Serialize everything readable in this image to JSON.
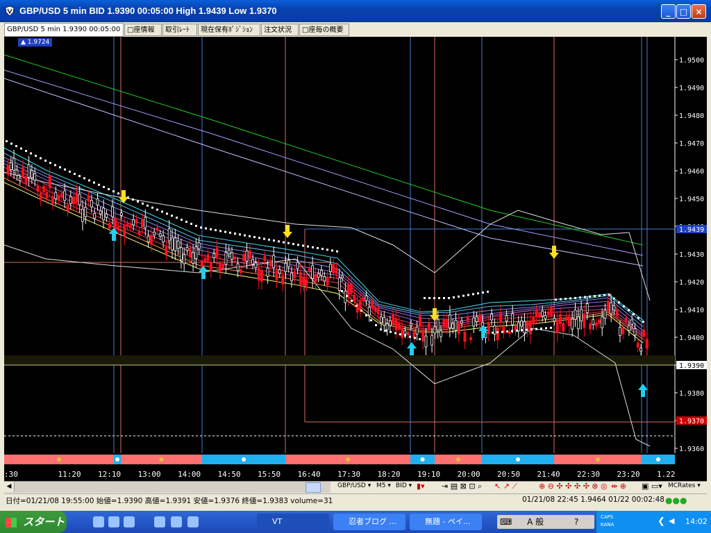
{
  "window": {
    "title": "GBP/USD 5 min BID 1.9390 00:05:00 High 1.9439 Low 1.9370",
    "buttons": {
      "minimize": "_",
      "maximize": "□",
      "close": "×"
    }
  },
  "tabs": [
    {
      "label": "GBP/USD 5 min 1.9390 00:05:00",
      "active": true
    },
    {
      "label": "□座情報",
      "active": false
    },
    {
      "label": "取引ﾚｰﾄ",
      "active": false
    },
    {
      "label": "現在保有ﾎﾟｼﾞｼｮﾝ",
      "active": false
    },
    {
      "label": "注文状況",
      "active": false
    },
    {
      "label": "□座毎の概要",
      "active": false
    }
  ],
  "chart": {
    "top_badge": "1.9724",
    "price_labels": [
      "1.9500",
      "1.9490",
      "1.9480",
      "1.9470",
      "1.9460",
      "1.9450",
      "1.9440",
      "1.9430",
      "1.9420",
      "1.9410",
      "1.9400",
      "1.9390",
      "1.9380",
      "1.9370",
      "1.9360"
    ],
    "price_tags": [
      {
        "text": "1.9439",
        "price": 1.9439,
        "bg": "#2040c0",
        "fg": "#ffffff"
      },
      {
        "text": "1.9390",
        "price": 1.939,
        "bg": "#ffffff",
        "fg": "#000000"
      },
      {
        "text": "1.9370",
        "price": 1.937,
        "bg": "#cc0000",
        "fg": "#ffffff"
      }
    ],
    "time_labels": [
      ":30",
      "11:20",
      "12:10",
      "13:00",
      "14:00",
      "14:50",
      "15:50",
      "16:40",
      "17:30",
      "18:20",
      "19:10",
      "20:00",
      "20:50",
      "21:40",
      "22:30",
      "23:20",
      "1.22"
    ],
    "colors": {
      "bull": "#ffffff",
      "bear": "#ff1020",
      "arrow_up": "#20d0f0",
      "arrow_down": "#ffe020",
      "session_a": "#ff7070",
      "session_b": "#20b0f0"
    }
  },
  "toolbar": {
    "symbol": "GBP/USD ▾",
    "timeframe": "M5 ▾",
    "side": "BID ▾",
    "rates": "MCRates ▾"
  },
  "statusbar": {
    "left": "日付=01/21/08 19:55:00 始値=1.9390 高値=1.9391 安値=1.9376 終値=1.9383 volume=31",
    "right": "01/21/08 22:45  1.9464  01/22 00:02:48"
  },
  "taskbar": {
    "start_label": "スタート",
    "tasks": [
      "VT",
      "忍者ブログ ...",
      "無題 - ペイ..."
    ],
    "ime": "A 般",
    "clock": "14:02",
    "caps": "CAPS",
    "kana": "KANA"
  }
}
